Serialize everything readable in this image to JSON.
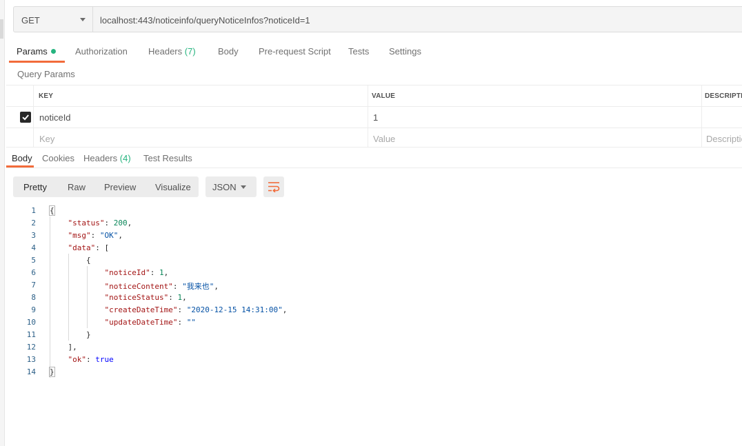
{
  "request": {
    "method": "GET",
    "url": "localhost:443/noticeinfo/queryNoticeInfos?noticeId=1"
  },
  "request_tabs": {
    "params": "Params",
    "authorization": "Authorization",
    "headers": "Headers",
    "headers_count": "(7)",
    "body": "Body",
    "prerequest": "Pre-request Script",
    "tests": "Tests",
    "settings": "Settings"
  },
  "query_params": {
    "title": "Query Params",
    "headers": {
      "key": "KEY",
      "value": "VALUE",
      "description": "DESCRIPTIO"
    },
    "rows": [
      {
        "key": "noticeId",
        "value": "1",
        "checked": true
      }
    ],
    "placeholders": {
      "key": "Key",
      "value": "Value",
      "description": "Descriptio"
    }
  },
  "response_tabs": {
    "body": "Body",
    "cookies": "Cookies",
    "headers": "Headers",
    "headers_count": "(4)",
    "test_results": "Test Results"
  },
  "format": {
    "pretty": "Pretty",
    "raw": "Raw",
    "preview": "Preview",
    "visualize": "Visualize",
    "language": "JSON"
  },
  "response_body": {
    "line_numbers": [
      "1",
      "2",
      "3",
      "4",
      "5",
      "6",
      "7",
      "8",
      "9",
      "10",
      "11",
      "12",
      "13",
      "14"
    ],
    "status_key": "\"status\"",
    "status_val": "200",
    "msg_key": "\"msg\"",
    "msg_val": "\"OK\"",
    "data_key": "\"data\"",
    "noticeId_key": "\"noticeId\"",
    "noticeId_val": "1",
    "noticeContent_key": "\"noticeContent\"",
    "noticeContent_val": "\"我来也\"",
    "noticeStatus_key": "\"noticeStatus\"",
    "noticeStatus_val": "1",
    "createDateTime_key": "\"createDateTime\"",
    "createDateTime_val": "\"2020-12-15 14:31:00\"",
    "updateDateTime_key": "\"updateDateTime\"",
    "updateDateTime_val": "\"\"",
    "ok_key": "\"ok\"",
    "ok_val": "true"
  },
  "icons": {
    "checkbox": "checkbox-checked-icon",
    "wrap": "wrap-lines-icon",
    "dropdown": "chevron-down-icon"
  },
  "colors": {
    "accent": "#f26b3a",
    "count": "#26b47f",
    "json_key": "#a31515",
    "json_string": "#0451a5",
    "json_number": "#098658"
  }
}
